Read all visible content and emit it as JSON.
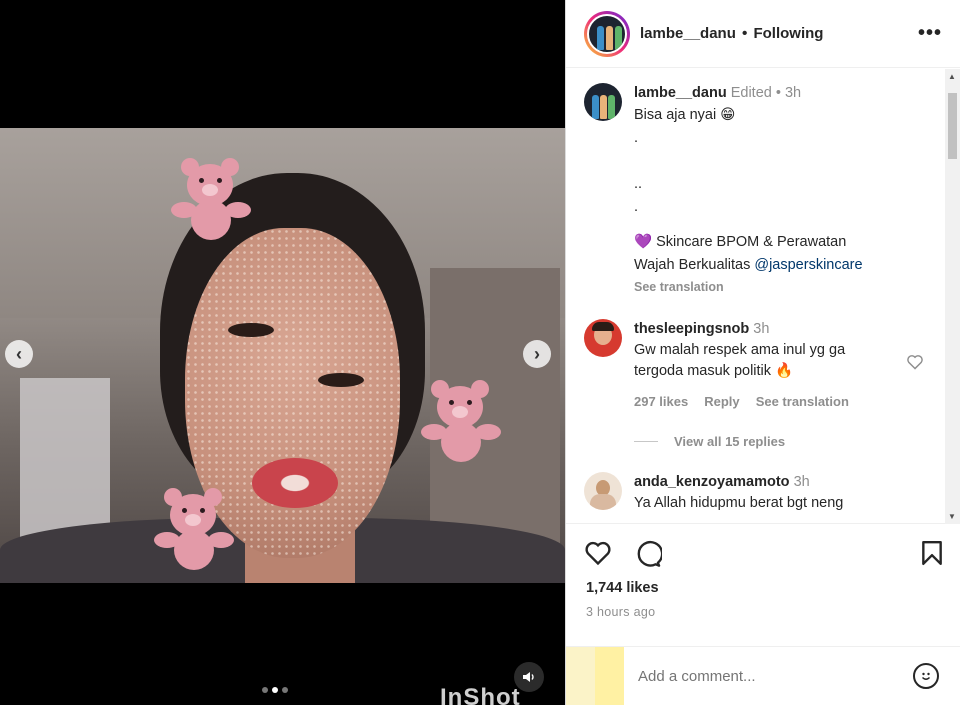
{
  "post": {
    "author": "lambe__danu",
    "separator": "•",
    "follow_status": "Following",
    "more_icon": "more-horizontal-icon"
  },
  "media": {
    "dots_total": 3,
    "dot_active": 2,
    "watermark": "InShot",
    "sound_icon": "speaker-icon",
    "prev_label": "‹",
    "next_label": "›"
  },
  "caption": {
    "author": "lambe__danu",
    "edited": "Edited",
    "time": "3h",
    "lines": [
      "Bisa aja nyai 😁",
      ".",
      "",
      "..",
      "."
    ],
    "promo_emoji": "💜",
    "promo_line1": "Skincare BPOM & Perawatan",
    "promo_line2": "Wajah Berkualitas",
    "promo_mention": "@jasperskincare",
    "see_translation": "See translation"
  },
  "comments": [
    {
      "author": "thesleepingsnob",
      "time": "3h",
      "line1": "Gw malah respek ama inul yg ga",
      "line2": "tergoda masuk politik 🔥",
      "likes": "297 likes",
      "reply": "Reply",
      "see_translation": "See translation",
      "view_replies": "View all 15 replies"
    },
    {
      "author": "anda_kenzoyamamoto",
      "time": "3h",
      "line1": "Ya Allah hidupmu berat bgt neng"
    }
  ],
  "actions": {
    "like_icon": "heart-icon",
    "comment_icon": "comment-icon",
    "save_icon": "bookmark-icon",
    "likes_count": "1,744 likes",
    "time_ago": "3 hours ago"
  },
  "comment_bar": {
    "placeholder": "Add a comment...",
    "emoji_icon": "smiley-icon"
  }
}
